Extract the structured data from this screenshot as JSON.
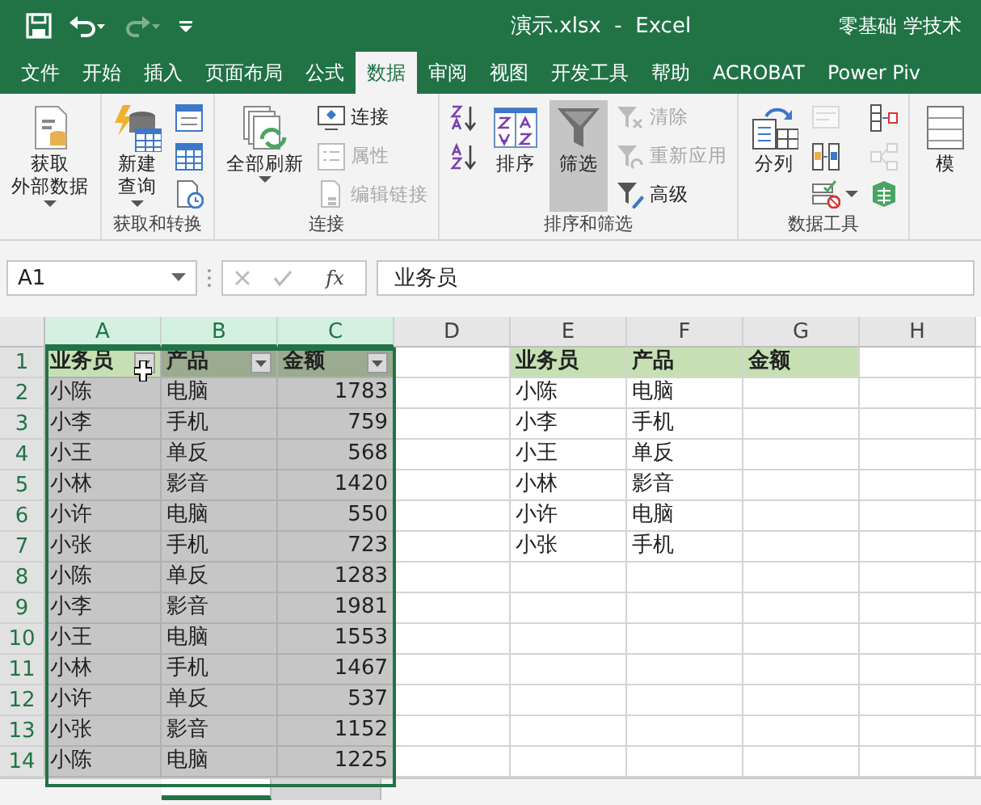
{
  "title_bar": {
    "title": "演示.xlsx  -  Excel",
    "user": "零基础 学技术",
    "redo_disabled": true
  },
  "menu_tabs": [
    {
      "label": "文件",
      "selected": false
    },
    {
      "label": "开始",
      "selected": false
    },
    {
      "label": "插入",
      "selected": false
    },
    {
      "label": "页面布局",
      "selected": false
    },
    {
      "label": "公式",
      "selected": false
    },
    {
      "label": "数据",
      "selected": true
    },
    {
      "label": "审阅",
      "selected": false
    },
    {
      "label": "视图",
      "selected": false
    },
    {
      "label": "开发工具",
      "selected": false
    },
    {
      "label": "帮助",
      "selected": false
    },
    {
      "label": "ACROBAT",
      "selected": false
    },
    {
      "label": "Power Piv",
      "selected": false
    }
  ],
  "ribbon": [
    {
      "items": [
        {
          "kind": "large",
          "lines": [
            "获取",
            "外部数据"
          ],
          "dropdown": true,
          "disabled": false,
          "selected": false
        }
      ]
    },
    {
      "label": "获取和转换",
      "items": [
        {
          "kind": "large",
          "lines": [
            "新建",
            "查询"
          ],
          "dropdown": true,
          "disabled": false,
          "selected": false
        },
        {
          "kind": "stack",
          "items": [
            {
              "disabled": false
            },
            {
              "disabled": false
            },
            {
              "disabled": false
            }
          ]
        }
      ]
    },
    {
      "label": "连接",
      "items": [
        {
          "kind": "large",
          "lines": [
            "全部刷新"
          ],
          "dropdown": true,
          "disabled": false,
          "selected": false
        },
        {
          "kind": "stack",
          "items": [
            {
              "label": "连接",
              "disabled": false
            },
            {
              "label": "属性",
              "disabled": true
            },
            {
              "label": "编辑链接",
              "disabled": true
            }
          ]
        }
      ]
    },
    {
      "label": "排序和筛选",
      "items": [
        {
          "kind": "stack",
          "items": [
            {
              "disabled": false
            },
            {
              "disabled": false
            }
          ]
        },
        {
          "kind": "large",
          "lines": [
            "排序"
          ],
          "dropdown": false,
          "disabled": false,
          "selected": false
        },
        {
          "kind": "large",
          "lines": [
            "筛选"
          ],
          "dropdown": false,
          "disabled": false,
          "selected": true
        },
        {
          "kind": "stack",
          "items": [
            {
              "label": "清除",
              "disabled": true
            },
            {
              "label": "重新应用",
              "disabled": true
            },
            {
              "label": "高级",
              "disabled": false
            }
          ]
        }
      ]
    },
    {
      "label": "数据工具",
      "items": [
        {
          "kind": "large",
          "lines": [
            "分列"
          ],
          "dropdown": false,
          "disabled": false,
          "selected": false
        },
        {
          "kind": "stack",
          "items": [
            {
              "disabled": true
            },
            {
              "disabled": false
            },
            {
              "disabled": false,
              "dropdown": true
            }
          ]
        },
        {
          "kind": "stack",
          "items": [
            {
              "disabled": false
            },
            {
              "disabled": true
            },
            {
              "disabled": false
            }
          ]
        }
      ]
    },
    {
      "items": [
        {
          "kind": "large",
          "lines": [
            "模"
          ],
          "dropdown": false,
          "disabled": false,
          "selected": false
        }
      ]
    }
  ],
  "formula_bar": {
    "name_box": "A1",
    "fx": "fx",
    "value": "业务员"
  },
  "sheet": {
    "columns": [
      {
        "label": "A",
        "selected": true
      },
      {
        "label": "B",
        "selected": true
      },
      {
        "label": "C",
        "selected": true
      },
      {
        "label": "D",
        "selected": false
      },
      {
        "label": "E",
        "selected": false
      },
      {
        "label": "F",
        "selected": false
      },
      {
        "label": "G",
        "selected": false
      },
      {
        "label": "H",
        "selected": false
      }
    ],
    "row_headers": [
      {
        "label": "1",
        "selected": true
      },
      {
        "label": "2",
        "selected": true
      },
      {
        "label": "3",
        "selected": true
      },
      {
        "label": "4",
        "selected": true
      },
      {
        "label": "5",
        "selected": true
      },
      {
        "label": "6",
        "selected": true
      },
      {
        "label": "7",
        "selected": true
      },
      {
        "label": "8",
        "selected": true
      },
      {
        "label": "9",
        "selected": true
      },
      {
        "label": "10",
        "selected": true
      },
      {
        "label": "11",
        "selected": true
      },
      {
        "label": "12",
        "selected": true
      },
      {
        "label": "13",
        "selected": true
      },
      {
        "label": "14",
        "selected": true
      }
    ],
    "tables": [
      {
        "selected": true,
        "header": [
          {
            "label": "业务员",
            "filter": true,
            "active": true,
            "kind": "text"
          },
          {
            "label": "产品",
            "filter": true,
            "active": false,
            "kind": "text"
          },
          {
            "label": "金额",
            "filter": true,
            "active": false,
            "kind": "number"
          }
        ],
        "rows": [
          [
            "小陈",
            "电脑",
            "1783"
          ],
          [
            "小李",
            "手机",
            "759"
          ],
          [
            "小王",
            "单反",
            "568"
          ],
          [
            "小林",
            "影音",
            "1420"
          ],
          [
            "小许",
            "电脑",
            "550"
          ],
          [
            "小张",
            "手机",
            "723"
          ],
          [
            "小陈",
            "单反",
            "1283"
          ],
          [
            "小李",
            "影音",
            "1981"
          ],
          [
            "小王",
            "电脑",
            "1553"
          ],
          [
            "小林",
            "手机",
            "1467"
          ],
          [
            "小许",
            "单反",
            "537"
          ],
          [
            "小张",
            "影音",
            "1152"
          ],
          [
            "小陈",
            "电脑",
            "1225"
          ]
        ]
      },
      {
        "selected": false,
        "header": [
          {
            "label": "业务员",
            "filter": false
          },
          {
            "label": "产品",
            "filter": false
          },
          {
            "label": "金额",
            "filter": false
          }
        ],
        "rows": [
          [
            "小陈",
            "电脑"
          ],
          [
            "小李",
            "手机"
          ],
          [
            "小王",
            "单反"
          ],
          [
            "小林",
            "影音"
          ],
          [
            "小许",
            "电脑"
          ],
          [
            "小张",
            "手机"
          ]
        ]
      }
    ]
  },
  "sheet_tabs": [
    {
      "selected": true
    },
    {
      "selected": false
    }
  ]
}
